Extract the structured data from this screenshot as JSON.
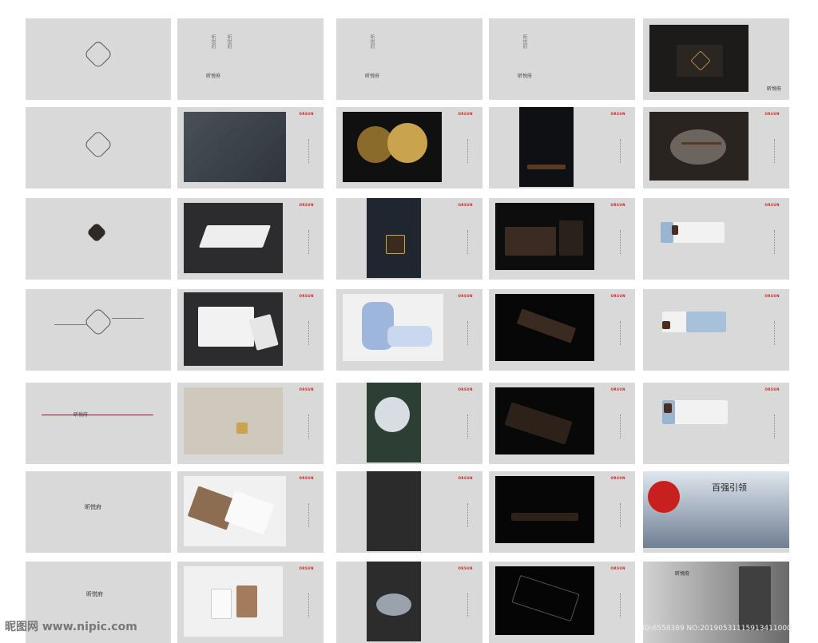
{
  "brand_signature": "昕悦府",
  "badge_text": "ORSUN",
  "row1": {
    "c2_sig": "昕悦府",
    "c3_sig": "昕悦府",
    "c4_sig": "昕悦府",
    "c5_sig": "昕悦府"
  },
  "row5": {
    "c1_label": "昕悦府"
  },
  "row6": {
    "c1_label": "昕悦府",
    "c5_headline": "百强引领"
  },
  "row7": {
    "c1_label": "昕悦府",
    "c5_headline": "昕悦府"
  },
  "watermark_left": "昵图网 www.nipic.com",
  "watermark_right": "ID:6558389 NO:20190531115913411000"
}
